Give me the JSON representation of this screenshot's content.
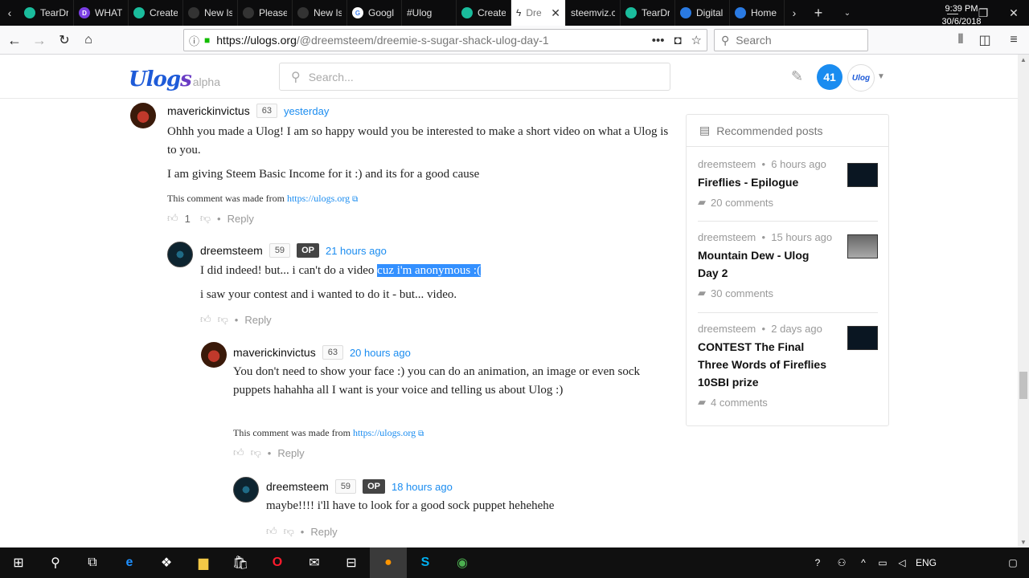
{
  "browser": {
    "tabs": [
      {
        "label": "TearDr",
        "color": "#1abc9c"
      },
      {
        "label": "WHAT",
        "color": "#7b3fe4"
      },
      {
        "label": "Create",
        "color": "#1abc9c"
      },
      {
        "label": "New Is",
        "color": "#333333"
      },
      {
        "label": "Please",
        "color": "#333333"
      },
      {
        "label": "New Is",
        "color": "#333333"
      },
      {
        "label": "Googl",
        "color": "#4285f4"
      },
      {
        "label": "#Ulog",
        "color": "#0c0c0d"
      },
      {
        "label": "Create",
        "color": "#1abc9c"
      },
      {
        "label": "Dre",
        "color": "#ffffff"
      },
      {
        "label": "steemviz.c",
        "color": "#0c0c0d"
      },
      {
        "label": "TearDr",
        "color": "#1abc9c"
      },
      {
        "label": "Digital",
        "color": "#2a7ae2"
      },
      {
        "label": "Home",
        "color": "#2a7ae2"
      }
    ],
    "url_host": "https://ulogs.org",
    "url_path": "/@dreemsteem/dreemie-s-sugar-shack-ulog-day-1",
    "search_placeholder": "Search"
  },
  "site": {
    "logo_main": "Ulog",
    "logo_suffix": "s",
    "alpha": "alpha",
    "search_placeholder": "Search...",
    "notif_count": "41"
  },
  "comments": [
    {
      "user": "maverickinvictus",
      "rep": "63",
      "time": "yesterday",
      "p1": "Ohhh you made a Ulog! I am so happy would you be interested to make a short video on what a Ulog is to you.",
      "p2": "I am giving Steem Basic Income for it :) and its for a good cause",
      "made_from": "This comment was made from ",
      "made_link": "https://ulogs.org",
      "votes": "1",
      "reply": "Reply"
    },
    {
      "user": "dreemsteem",
      "rep": "59",
      "op": "OP",
      "time": "21 hours ago",
      "p1a": "I did indeed! but... i can't do a video ",
      "p1b": "cuz i'm anonymous :(",
      "p2": "i saw your contest and i wanted to do it - but... video.",
      "reply": "Reply"
    },
    {
      "user": "maverickinvictus",
      "rep": "63",
      "time": "20 hours ago",
      "p1": "You don't need to show your face :) you can do an animation, an image or even sock puppets hahahha all I want is your voice and telling us about Ulog :)",
      "made_from": "This comment was made from ",
      "made_link": "https://ulogs.org",
      "reply": "Reply"
    },
    {
      "user": "dreemsteem",
      "rep": "59",
      "op": "OP",
      "time": "18 hours ago",
      "p1": "maybe!!!! i'll have to look for a good sock puppet hehehehe",
      "reply": "Reply"
    }
  ],
  "recommended": {
    "title": "Recommended posts",
    "items": [
      {
        "author": "dreemsteem",
        "time": "6 hours ago",
        "title": "Fireflies - Epilogue",
        "comments": "20 comments"
      },
      {
        "author": "dreemsteem",
        "time": "15 hours ago",
        "title": "Mountain Dew - Ulog Day 2",
        "comments": "30 comments"
      },
      {
        "author": "dreemsteem",
        "time": "2 days ago",
        "title": "CONTEST The Final Three Words of Fireflies 10SBI prize",
        "comments": "4 comments"
      }
    ]
  },
  "taskbar": {
    "lang": "ENG",
    "time": "9:39 PM",
    "date": "30/6/2018"
  }
}
